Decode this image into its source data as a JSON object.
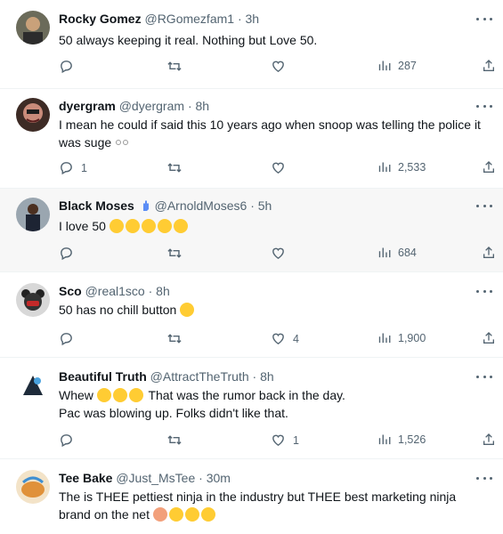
{
  "tweets": [
    {
      "name": "Rocky Gomez",
      "handle": "@RGomezfam1",
      "time": "3h",
      "text": "50 always keeping it real. Nothing but Love 50.",
      "emoji": [],
      "replies": "",
      "retweets": "",
      "likes": "",
      "views": "287"
    },
    {
      "name": "dyergram",
      "handle": "@dyergram",
      "time": "8h",
      "text": "I mean he could if said this 10 years ago when snoop was telling the police it was suge",
      "emoji": [
        "eyes"
      ],
      "replies": "1",
      "retweets": "",
      "likes": "",
      "views": "2,533"
    },
    {
      "name": "Black Moses",
      "handle": "@ArnoldMoses6",
      "time": "5h",
      "text": "I love 50",
      "emoji": [
        "joy",
        "joy",
        "joy",
        "joy",
        "joy"
      ],
      "replies": "",
      "retweets": "",
      "likes": "",
      "views": "684"
    },
    {
      "name": "Sco",
      "handle": "@real1sco",
      "time": "8h",
      "text": "50 has no chill button",
      "emoji": [
        "joy"
      ],
      "replies": "",
      "retweets": "",
      "likes": "4",
      "views": "1,900"
    },
    {
      "name": "Beautiful Truth",
      "handle": "@AttractTheTruth",
      "time": "8h",
      "text_before": "Whew",
      "emoji": [
        "disappointed-relieved",
        "disappointed-relieved",
        "disappointed-relieved"
      ],
      "text": "That was the rumor back in the day.",
      "text2": "Pac was blowing up. Folks didn't like that.",
      "replies": "",
      "retweets": "",
      "likes": "1",
      "views": "1,526"
    },
    {
      "name": "Tee Bake",
      "handle": "@Just_MsTee",
      "time": "30m",
      "text": "The is THEE pettiest ninja in the industry but THEE best marketing ninja",
      "text2": "brand on the net",
      "emoji": [
        "person-facepalming",
        "joy",
        "joy",
        "joy"
      ]
    }
  ],
  "icons": {
    "reply": "reply-icon",
    "retweet": "retweet-icon",
    "like": "like-icon",
    "views": "views-icon",
    "share": "share-icon",
    "more": "more-icon"
  },
  "colors": {
    "text": "#0f1419",
    "secondary": "#536471",
    "highlight_bg": "#f7f7f7",
    "emoji": "#ffcc33"
  }
}
